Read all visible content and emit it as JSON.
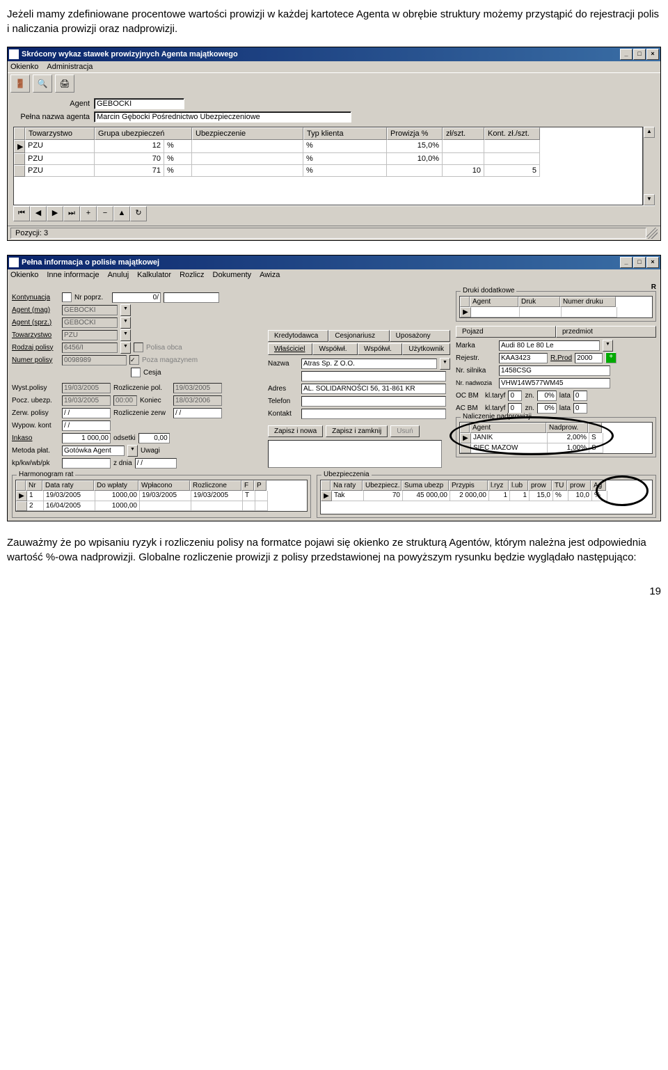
{
  "doc": {
    "para1": "Jeżeli mamy zdefiniowane procentowe wartości prowizji w każdej kartotece Agenta w obrębie struktury możemy przystąpić do rejestracji polis i naliczania prowizji oraz nadprowizji.",
    "para2": "Zauważmy że po wpisaniu ryzyk i rozliczeniu polisy na formatce pojawi się okienko ze strukturą Agentów, którym należna jest odpowiednia wartość %-owa nadprowizji. Globalne rozliczenie prowizji z polisy przedstawionej na powyższym rysunku będzie wyglądało następująco:",
    "page_number": "19"
  },
  "win1": {
    "title": "Skrócony wykaz stawek prowizyjnych Agenta majątkowego",
    "menus": [
      "Okienko",
      "Administracja"
    ],
    "labels": {
      "agent": "Agent",
      "full_name": "Pełna nazwa agenta"
    },
    "agent_code": "GEBOCKI",
    "agent_full": "Marcin Gębocki Pośrednictwo Ubezpieczeniowe",
    "columns": [
      "Towarzystwo",
      "Grupa ubezpieczeń",
      "Ubezpieczenie",
      "Typ klienta",
      "Prowizja %",
      "zł/szt.",
      "Kont. zł./szt."
    ],
    "rows": [
      {
        "marker": "▶",
        "tow": "PZU",
        "grp": "12",
        "grp_sym": "%",
        "ubz": "",
        "typ": "%",
        "prow": "15,0%",
        "zlszt": "",
        "kont": ""
      },
      {
        "marker": "",
        "tow": "PZU",
        "grp": "70",
        "grp_sym": "%",
        "ubz": "",
        "typ": "%",
        "prow": "10,0%",
        "zlszt": "",
        "kont": ""
      },
      {
        "marker": "",
        "tow": "PZU",
        "grp": "71",
        "grp_sym": "%",
        "ubz": "",
        "typ": "%",
        "prow": "",
        "zlszt": "10",
        "kont": "5"
      }
    ],
    "status": "Pozycji: 3"
  },
  "win2": {
    "title": "Pełna informacja o polisie majątkowej",
    "menus": [
      "Okienko",
      "Inne informacje",
      "Anuluj",
      "Kalkulator",
      "Rozlicz",
      "Dokumenty",
      "Awiza"
    ],
    "labels": {
      "kontynuacja": "Kontynuacja",
      "nr_poprz": "Nr poprz.",
      "zero_slash": "0/",
      "agent_mag": "Agent (mag)",
      "agent_sprz": "Agent (sprz.)",
      "towarzystwo": "Towarzystwo",
      "rodzaj_polisy": "Rodzaj polisy",
      "numer_polisy": "Numer polisy",
      "polisa_obca": "Polisa obca",
      "poza_mag": "Poza magazynem",
      "cesja": "Cesja",
      "wyst_polisy": "Wyst.polisy",
      "pocz_ubezp": "Pocz. ubezp.",
      "zerw_polisy": "Zerw. polisy",
      "wypow_kont": "Wypow. kont",
      "inkaso": "Inkaso",
      "metoda_plat": "Metoda płat.",
      "kpkw": "kp/kw/wb/pk",
      "rozl_pol": "Rozliczenie pol.",
      "koniec": "Koniec",
      "rozl_zerw": "Rozliczenie zerw",
      "godz": "00:00",
      "odsetki": "odsetki",
      "z_dnia": "z dnia",
      "uwagi": "Uwagi",
      "kredytodawca": "Kredytodawca",
      "cesjonariusz": "Cesjonariusz",
      "uposazony": "Uposażony",
      "wlasciciel": "Właściciel",
      "wspolwl1": "Współwł.",
      "wspolwl2": "Współwł.",
      "uzytkownik": "Użytkownik",
      "nazwa": "Nazwa",
      "adres": "Adres",
      "telefon": "Telefon",
      "kontakt": "Kontakt",
      "zapisz_nowa": "Zapisz i nowa",
      "zapisz_zamknij": "Zapisz i zamknij",
      "usun": "Usuń",
      "druki": "Druki dodatkowe",
      "agent_col": "Agent",
      "druk_col": "Druk",
      "numer_druku": "Numer druku",
      "pojazd": "Pojazd",
      "przedmiot": "przedmiot",
      "marka": "Marka",
      "rejestr": "Rejestr.",
      "rprod": "R.Prod",
      "nr_silnika": "Nr. silnika",
      "nr_nadwozia": "Nr. nadwozia",
      "oc_bm": "OC BM",
      "ac_bm": "AC BM",
      "kl_taryf": "kl.taryf",
      "zn": "zn.",
      "lata": "lata",
      "naliczenie": "Naliczenie nadprowizji",
      "nadprow": "Nadprow.",
      "harmonogram": "Harmonogram rat",
      "ubezpieczenia": "Ubezpieczenia",
      "r_flag": "R"
    },
    "values": {
      "agent_mag": "GEBOCKI",
      "agent_sprz": "GEBOCKI",
      "towarzystwo": "PZU",
      "rodzaj_polisy": "6456/I",
      "numer_polisy": "0098989",
      "wyst_polisy": "19/03/2005",
      "pocz_ubezp": "19/03/2005",
      "zerw_polisy": "  /  /",
      "wypow_kont": "  /  /",
      "rozl_pol": "19/03/2005",
      "koniec": "18/03/2006",
      "rozl_zerw": "  /  /",
      "inkaso": "1 000,00",
      "odsetki": "0,00",
      "metoda_plat": "Gotówka Agent",
      "z_dnia": "  /  /",
      "nazwa": "Atras Sp. Z O.O.",
      "adres": "AL. SOLIDARNOŚCI 56, 31-861 KR",
      "marka": "Audi 80 Le 80 Le",
      "rejestr": "KAA3423",
      "rprod": "2000",
      "nr_silnika": "1458CSG",
      "nr_nadwozia": "VHW14W577WM45",
      "oc_taryf": "0",
      "oc_zn": "0%",
      "oc_lata": "0",
      "ac_taryf": "0",
      "ac_zn": "0%",
      "ac_lata": "0"
    },
    "nadprow_rows": [
      {
        "agent": "JANIK",
        "pct": "2,00%",
        "s": "S"
      },
      {
        "agent": "SIEC MAZOW",
        "pct": "1,00%",
        "s": "S"
      }
    ],
    "harm_cols": [
      "Nr",
      "Data raty",
      "Do wpłaty",
      "Wpłacono",
      "Rozliczone",
      "F",
      "P"
    ],
    "harm_rows": [
      {
        "nr": "1",
        "data": "19/03/2005",
        "do": "1000,00",
        "wpl": "19/03/2005",
        "roz": "19/03/2005",
        "f": "T",
        "p": ""
      },
      {
        "nr": "2",
        "data": "16/04/2005",
        "do": "1000,00",
        "wpl": "",
        "roz": "",
        "f": "",
        "p": ""
      }
    ],
    "ubez_cols": [
      "Na raty",
      "Ubezpiecz.",
      "Suma ubezp",
      "Przypis",
      "l.ryz",
      "l.ub",
      "prow",
      "TU",
      "prow",
      "Ag"
    ],
    "ubez_rows": [
      {
        "raty": "Tak",
        "ub": "70",
        "suma": "45 000,00",
        "przypis": "2 000,00",
        "lryz": "1",
        "lub": "1",
        "prow1": "15,0",
        "tu": "%",
        "prow2": "10,0",
        "ag": "%"
      }
    ]
  }
}
